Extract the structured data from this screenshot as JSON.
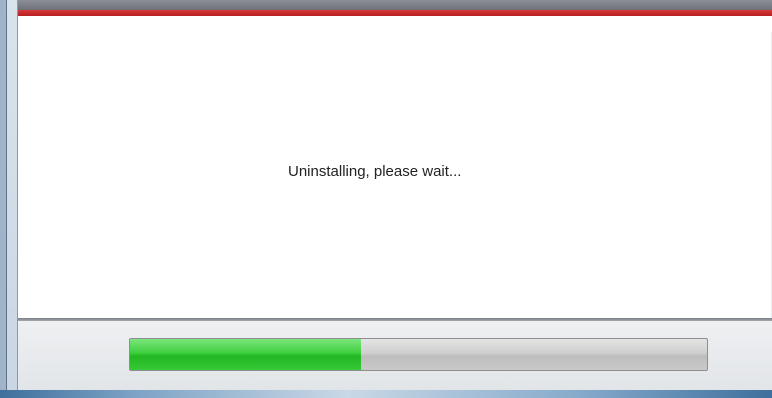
{
  "dialog": {
    "status_text": "Uninstalling, please wait..."
  },
  "progress": {
    "percent": 40,
    "fill_color": "#2fc42f",
    "track_color": "#c8c8c8"
  },
  "colors": {
    "accent": "#c92a2a"
  }
}
